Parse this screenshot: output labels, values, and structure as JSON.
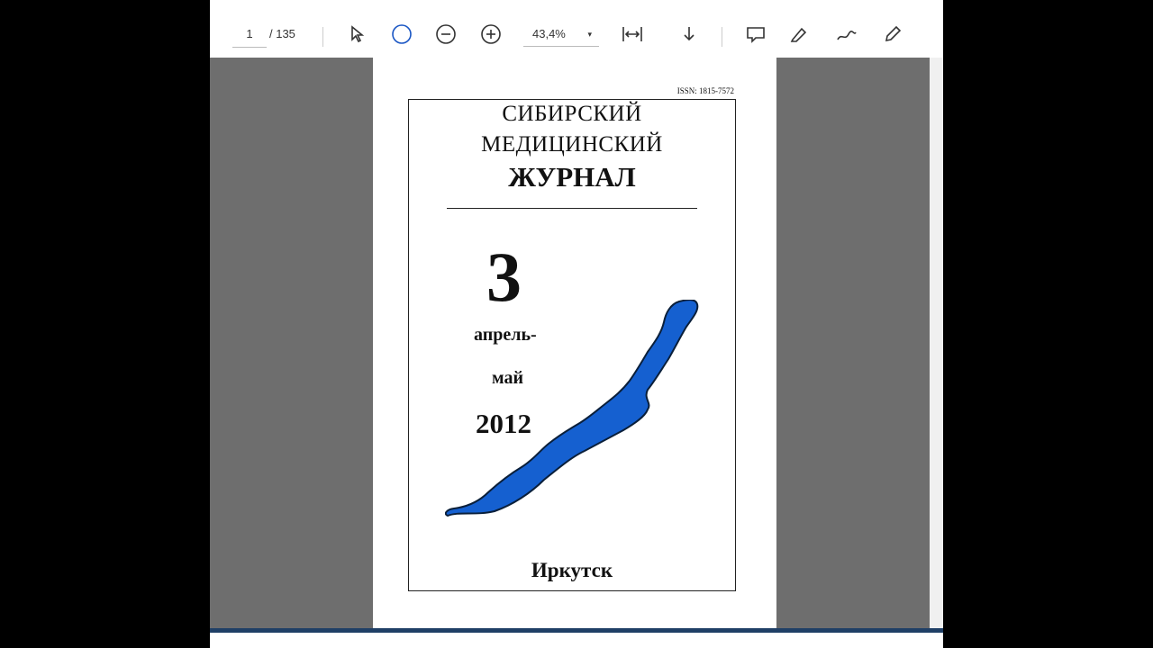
{
  "toolbar": {
    "page_current": "1",
    "page_total": "/ 135",
    "zoom": "43,4%"
  },
  "cover": {
    "issn": "ISSN: 1815-7572",
    "title_line1": "СИБИРСКИЙ",
    "title_line2": "МЕДИЦИНСКИЙ",
    "title_line3": "ЖУРНАЛ",
    "issue_number": "3",
    "months_line1": "апрель-",
    "months_line2": "май",
    "year": "2012",
    "city": "Иркутск"
  },
  "colors": {
    "lake": "#1560d0",
    "viewer_bg": "#6e6e6e"
  },
  "icons": [
    "select-cursor-icon",
    "fit-page-icon",
    "zoom-out-icon",
    "zoom-in-icon",
    "fit-width-icon",
    "download-icon",
    "comment-icon",
    "highlight-icon",
    "draw-icon",
    "edit-icon"
  ]
}
